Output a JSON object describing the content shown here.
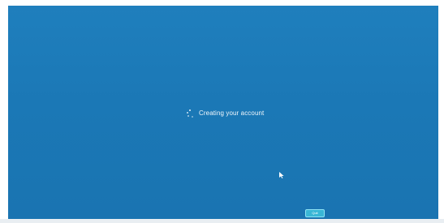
{
  "screen": {
    "status_text": "Creating your account",
    "cursor_icon": "mouse-pointer-icon",
    "spinner_icon": "loading-spinner-icon",
    "button_label": "Quit"
  },
  "colors": {
    "background": "#1b78b6",
    "text": "#f2f8fc",
    "button": "#39b7d6"
  }
}
